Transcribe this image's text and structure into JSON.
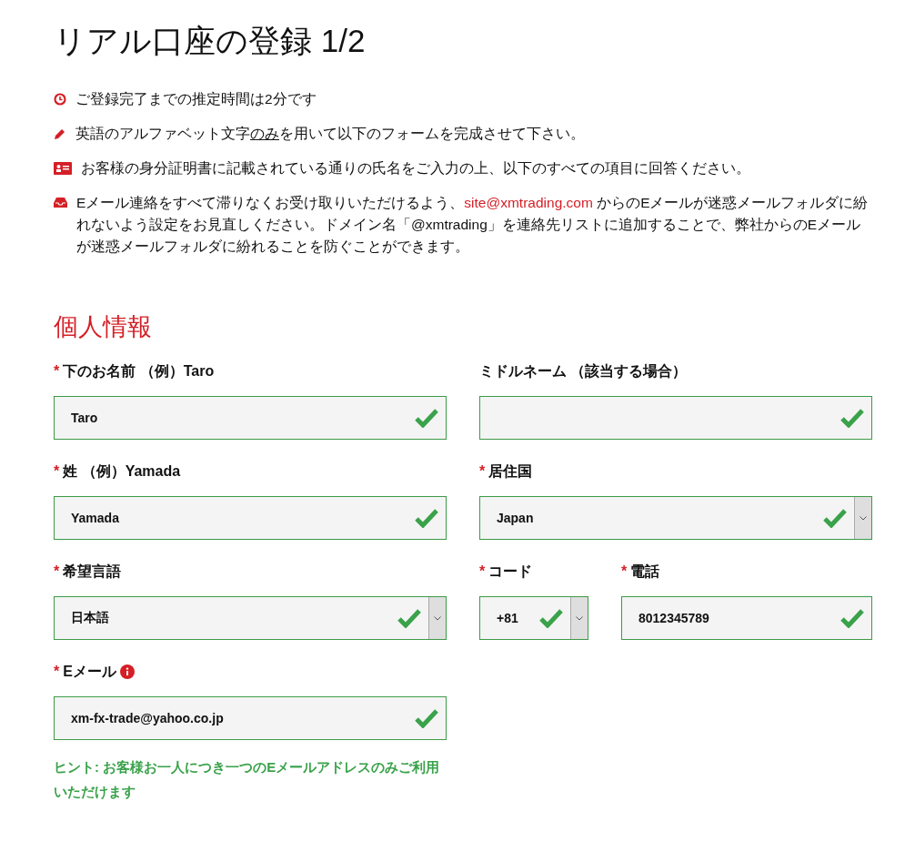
{
  "title": "リアル口座の登録 1/2",
  "notices": [
    {
      "kind": "clock",
      "parts": [
        {
          "kind": "plain",
          "text": "ご登録完了までの推定時間は2分です"
        }
      ]
    },
    {
      "kind": "pencil",
      "parts": [
        {
          "kind": "plain",
          "text": "英語のアルファベット文字"
        },
        {
          "kind": "underline",
          "text": "のみ"
        },
        {
          "kind": "plain",
          "text": "を用いて以下のフォームを完成させて下さい。"
        }
      ]
    },
    {
      "kind": "id-card",
      "parts": [
        {
          "kind": "plain",
          "text": "お客様の身分証明書に記載されている通りの氏名をご入力の上、以下のすべての項目に回答ください。"
        }
      ]
    },
    {
      "kind": "inbox",
      "parts": [
        {
          "kind": "plain",
          "text": "Eメール連絡をすべて滞りなくお受け取りいただけるよう、"
        },
        {
          "kind": "link",
          "text": "site@xmtrading.com"
        },
        {
          "kind": "plain",
          "text": " からのEメールが迷惑メールフォルダに紛れないよう設定をお見直しください。ドメイン名「@xmtrading」を連絡先リストに追加することで、弊社からのEメールが迷惑メールフォルダに紛れることを防ぐことができます。"
        }
      ]
    }
  ],
  "section_title": "個人情報",
  "rows": [
    [
      [
        {
          "kind": "text",
          "required_mark": "*",
          "label": "下のお名前 （例）Taro",
          "value": "Taro",
          "valid": true
        }
      ],
      [
        {
          "kind": "text",
          "label": "ミドルネーム （該当する場合）",
          "valid": true
        }
      ]
    ],
    [
      [
        {
          "kind": "text",
          "required_mark": "*",
          "label": "姓 （例）Yamada",
          "value": "Yamada",
          "valid": true
        }
      ],
      [
        {
          "kind": "select",
          "required_mark": "*",
          "label": "居住国",
          "value": "Japan",
          "valid": true
        }
      ]
    ],
    [
      [
        {
          "kind": "select",
          "required_mark": "*",
          "label": "希望言語",
          "value": "日本語",
          "valid": true
        }
      ],
      [
        {
          "kind": "select",
          "required_mark": "*",
          "label": "コード",
          "value": "+81",
          "valid": true
        },
        {
          "kind": "text",
          "required_mark": "*",
          "label": "電話",
          "value": "8012345789",
          "valid": true
        }
      ]
    ],
    [
      [
        {
          "kind": "text",
          "required_mark": "*",
          "label": "Eメール",
          "info": true,
          "value": "xm-fx-trade@yahoo.co.jp",
          "valid": true,
          "hint": "ヒント: お客様お一人につき一つのEメールアドレスのみご利用いただけます"
        }
      ],
      []
    ]
  ]
}
